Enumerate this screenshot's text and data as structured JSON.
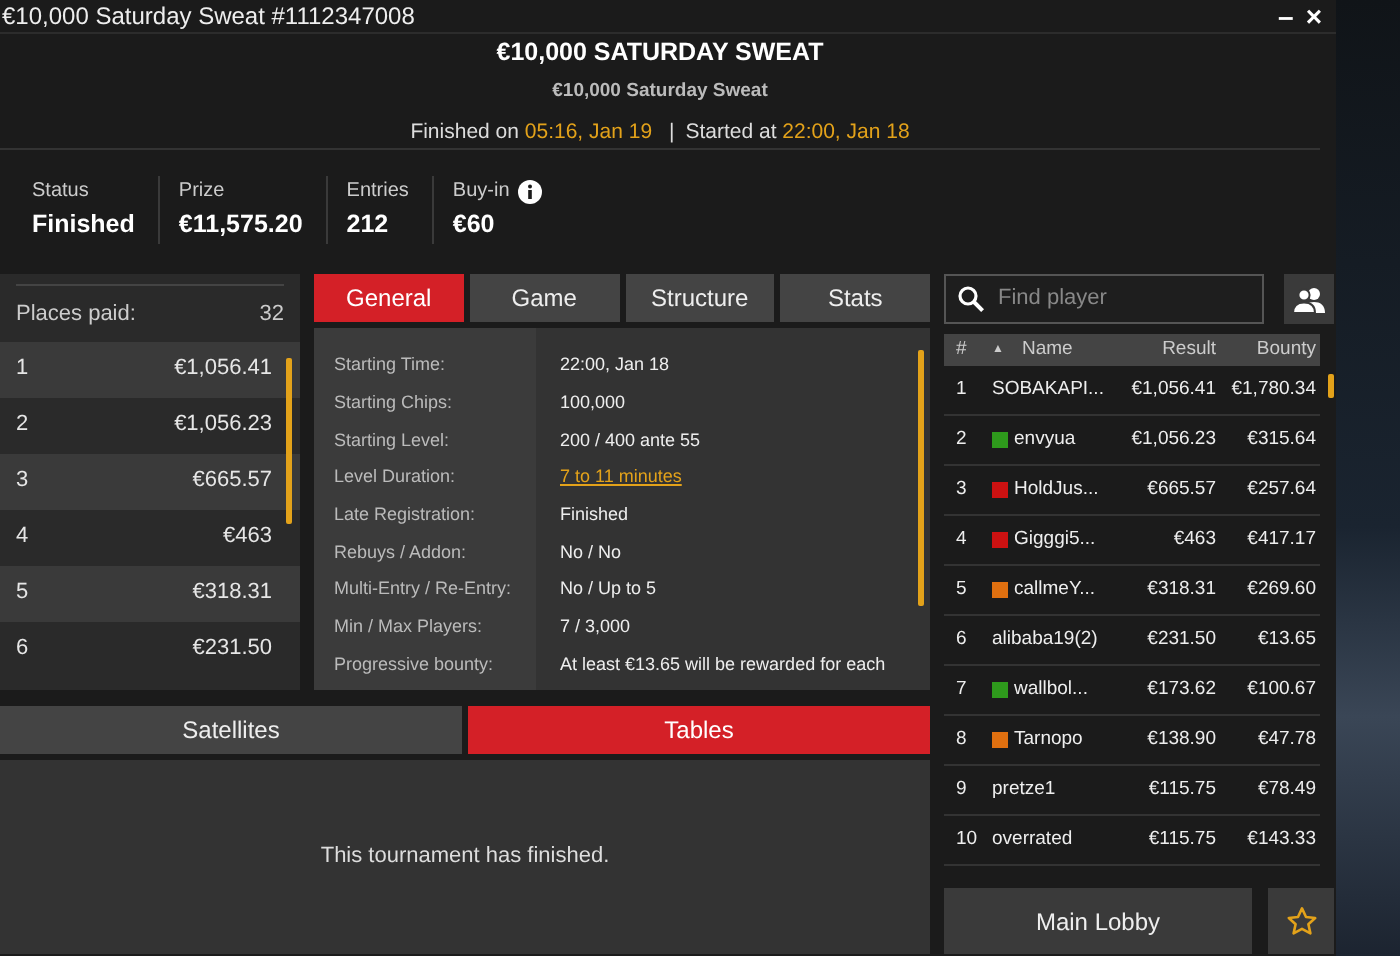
{
  "window": {
    "title": "€10,000 Saturday Sweat #1112347008",
    "controls": [
      "–",
      "×"
    ]
  },
  "header": {
    "title": "€10,000 SATURDAY SWEAT",
    "subtitle": "€10,000 Saturday Sweat",
    "finished_label": "Finished on",
    "finished_value": "05:16, Jan 19",
    "separator": "|",
    "started_label": "Started at",
    "started_value": "22:00, Jan 18"
  },
  "stats": [
    {
      "label": "Status",
      "value": "Finished",
      "info": false
    },
    {
      "label": "Prize",
      "value": "€11,575.20",
      "info": false
    },
    {
      "label": "Entries",
      "value": "212",
      "info": false
    },
    {
      "label": "Buy-in",
      "value": "€60",
      "info": true
    }
  ],
  "prizes": {
    "label": "Places paid:",
    "count": "32",
    "rows": [
      {
        "place": "1",
        "amount": "€1,056.41"
      },
      {
        "place": "2",
        "amount": "€1,056.23"
      },
      {
        "place": "3",
        "amount": "€665.57"
      },
      {
        "place": "4",
        "amount": "€463"
      },
      {
        "place": "5",
        "amount": "€318.31"
      },
      {
        "place": "6",
        "amount": "€231.50"
      }
    ]
  },
  "info_tabs": [
    {
      "label": "General",
      "selected": true
    },
    {
      "label": "Game",
      "selected": false
    },
    {
      "label": "Structure",
      "selected": false
    },
    {
      "label": "Stats",
      "selected": false
    }
  ],
  "general": [
    {
      "label": "Starting Time:",
      "value": "22:00, Jan 18",
      "kind": "text"
    },
    {
      "label": "Starting Chips:",
      "value": "100,000",
      "kind": "text"
    },
    {
      "label": "Starting Level:",
      "value": "200 / 400 ante 55",
      "kind": "text"
    },
    {
      "label": "Level Duration:",
      "value": "7 to 11 minutes",
      "kind": "link"
    },
    {
      "label": "Late Registration:",
      "value": "Finished",
      "kind": "text"
    },
    {
      "label": "Rebuys / Addon:",
      "value": "No / No",
      "kind": "text"
    },
    {
      "label": "Multi-Entry / Re-Entry:",
      "value": "No / Up to 5",
      "kind": "text"
    },
    {
      "label": "Min / Max Players:",
      "value": "7 / 3,000",
      "kind": "text"
    },
    {
      "label": "Progressive bounty:",
      "value": "At least €13.65 will be rewarded for each",
      "kind": "text"
    }
  ],
  "bottom_tabs": [
    {
      "label": "Satellites",
      "selected": false
    },
    {
      "label": "Tables",
      "selected": true
    }
  ],
  "bottom_message": "This tournament has finished.",
  "search": {
    "placeholder": "Find player"
  },
  "players": {
    "columns": [
      "#",
      "Name",
      "Result",
      "Bounty"
    ],
    "sort_mark": "▲",
    "rows": [
      {
        "rank": "1",
        "name": "SOBAKAPI...",
        "result": "€1,056.41",
        "bounty": "€1,780.34"
      },
      {
        "rank": "2",
        "name": "envyua",
        "result": "€1,056.23",
        "bounty": "€315.64",
        "color": "#2e9a1c"
      },
      {
        "rank": "3",
        "name": "HoldJus...",
        "result": "€665.57",
        "bounty": "€257.64",
        "color": "#cc1111"
      },
      {
        "rank": "4",
        "name": "Gigggi5...",
        "result": "€463",
        "bounty": "€417.17",
        "color": "#cc1111"
      },
      {
        "rank": "5",
        "name": "callmeY...",
        "result": "€318.31",
        "bounty": "€269.60",
        "color": "#e07010"
      },
      {
        "rank": "6",
        "name": "alibaba19(2)",
        "result": "€231.50",
        "bounty": "€13.65"
      },
      {
        "rank": "7",
        "name": "wallbol...",
        "result": "€173.62",
        "bounty": "€100.67",
        "color": "#2e9a1c"
      },
      {
        "rank": "8",
        "name": "Tarnopo",
        "result": "€138.90",
        "bounty": "€47.78",
        "color": "#e07010"
      },
      {
        "rank": "9",
        "name": "pretze1",
        "result": "€115.75",
        "bounty": "€78.49"
      },
      {
        "rank": "10",
        "name": "overrated",
        "result": "€115.75",
        "bounty": "€143.33"
      }
    ]
  },
  "main_lobby": "Main Lobby"
}
